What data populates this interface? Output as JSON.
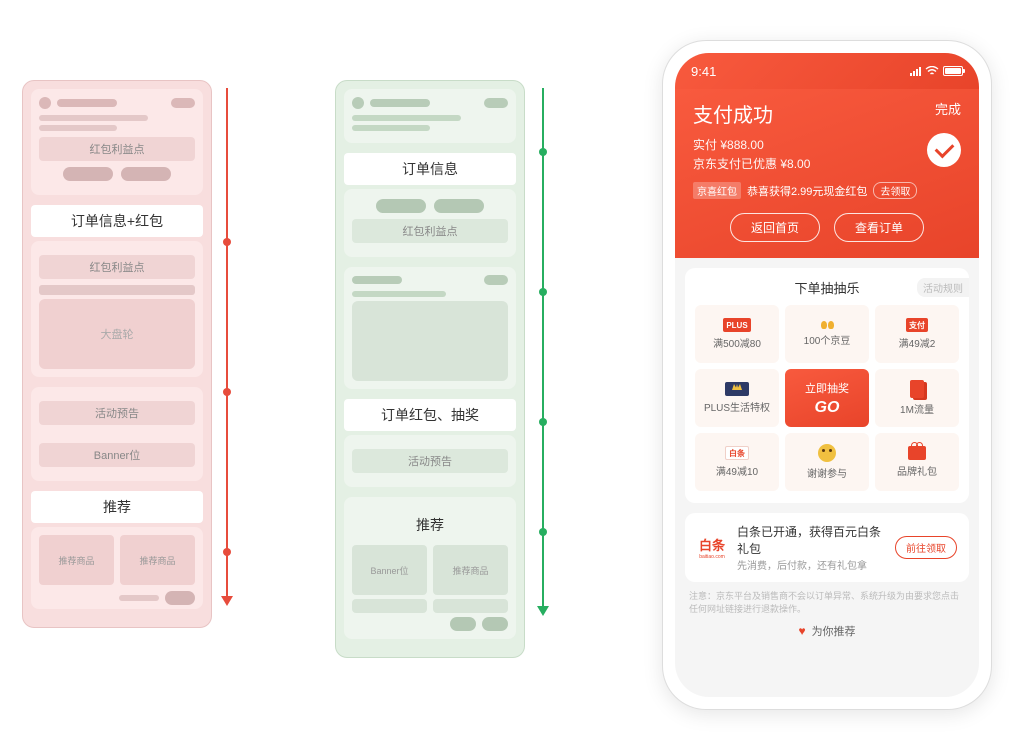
{
  "wireframe_red": {
    "sections": {
      "order_bonus": "订单信息+红包",
      "bonus_point": "红包利益点",
      "big_turntable": "大盘轮",
      "activity_preview": "活动预告",
      "banner": "Banner位",
      "recommend": "推荐",
      "rec_item": "推荐商品"
    }
  },
  "wireframe_green": {
    "sections": {
      "order_info": "订单信息",
      "bonus_point": "红包利益点",
      "order_bonus_lottery": "订单红包、抽奖",
      "activity_preview": "活动预告",
      "recommend": "推荐",
      "banner": "Banner位",
      "rec_item": "推荐商品"
    }
  },
  "phone": {
    "status": {
      "time": "9:41"
    },
    "header": {
      "done": "完成",
      "title": "支付成功",
      "paid_label": "实付",
      "paid_amount": "¥888.00",
      "discount_label": "京东支付已优惠",
      "discount_amount": "¥8.00",
      "rp_badge": "京喜红包",
      "rp_text": "恭喜获得2.99元现金红包",
      "rp_go": "去领取",
      "btn_home": "返回首页",
      "btn_order": "查看订单"
    },
    "lottery": {
      "title": "下单抽抽乐",
      "rules": "活动规则",
      "go_label": "立即抽奖",
      "go_text": "GO",
      "cells": [
        {
          "icon": "plus",
          "label": "满500减80"
        },
        {
          "icon": "gold",
          "label": "100个京豆"
        },
        {
          "icon": "pay",
          "label": "满49减2"
        },
        {
          "icon": "crown",
          "label": "PLUS生活特权"
        },
        {
          "icon": "center",
          "label": ""
        },
        {
          "icon": "card",
          "label": "1M流量"
        },
        {
          "icon": "bt",
          "label": "满49减10"
        },
        {
          "icon": "face",
          "label": "谢谢参与"
        },
        {
          "icon": "gift",
          "label": "品牌礼包"
        }
      ],
      "icon_text": {
        "plus": "PLUS",
        "pay": "支付",
        "bt": "白条"
      }
    },
    "baitiao": {
      "logo": "白条",
      "logo_sub": "baitiao.com",
      "title": "白条已开通，获得百元白条礼包",
      "sub": "先消费，后付款，还有礼包拿",
      "btn": "前往领取"
    },
    "notice": "注意：京东平台及销售商不会以订单异常、系统升级为由要求您点击任何网址链接进行退款操作。",
    "recommend": "为你推荐"
  }
}
